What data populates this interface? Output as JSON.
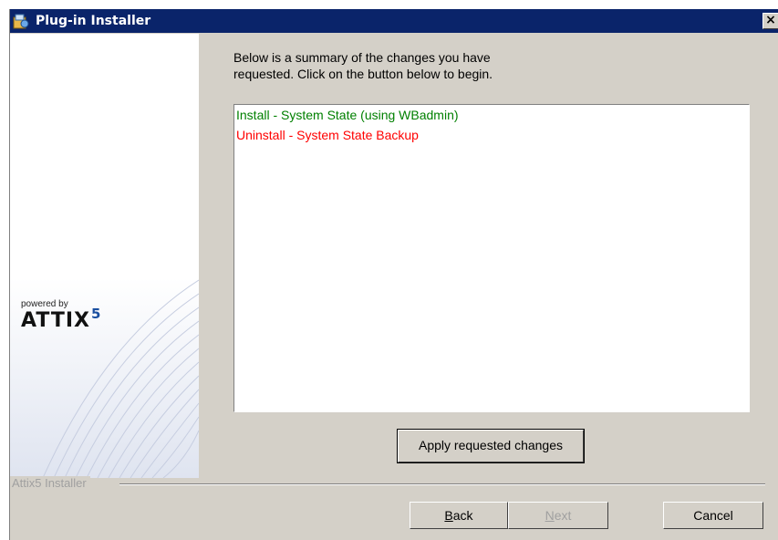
{
  "window": {
    "title": "Plug-in Installer",
    "close_glyph": "×"
  },
  "sidebar": {
    "powered_by": "powered by",
    "brand": "ATTIX",
    "brand_superscript": "5"
  },
  "summary": {
    "line1": "Below is a summary of the changes you have",
    "line2": "requested. Click on the button below to begin."
  },
  "changes": [
    {
      "text": "Install - System State (using WBadmin)",
      "color": "#008000"
    },
    {
      "text": "Uninstall - System State Backup",
      "color": "#ff0000"
    }
  ],
  "buttons": {
    "apply": "Apply requested changes",
    "back_underlined": "B",
    "back_rest": "ack",
    "next_underlined": "N",
    "next_rest": "ext",
    "cancel": "Cancel"
  },
  "footer": {
    "group_label": "Attix5 Installer"
  },
  "colors": {
    "title_bar": "#0a246a",
    "dialog_face": "#d4d0c8",
    "install": "#008000",
    "uninstall": "#ff0000"
  }
}
